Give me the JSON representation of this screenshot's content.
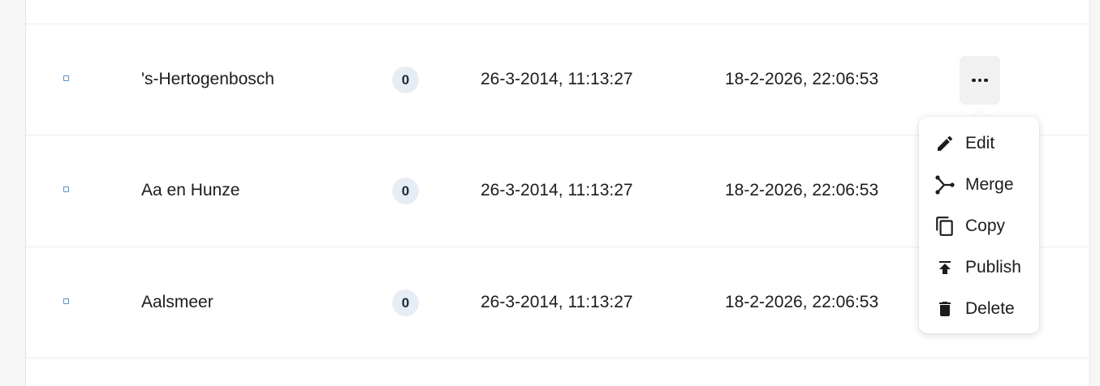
{
  "rows": [
    {
      "name": "'s-Hertogenbosch",
      "count": "0",
      "created": "26-3-2014, 11:13:27",
      "modified": "18-2-2026, 22:06:53"
    },
    {
      "name": "Aa en Hunze",
      "count": "0",
      "created": "26-3-2014, 11:13:27",
      "modified": "18-2-2026, 22:06:53"
    },
    {
      "name": "Aalsmeer",
      "count": "0",
      "created": "26-3-2014, 11:13:27",
      "modified": "18-2-2026, 22:06:53"
    }
  ],
  "context_menu": {
    "items": [
      {
        "label": "Edit",
        "icon": "pencil-icon"
      },
      {
        "label": "Merge",
        "icon": "merge-icon"
      },
      {
        "label": "Copy",
        "icon": "copy-icon"
      },
      {
        "label": "Publish",
        "icon": "publish-icon"
      },
      {
        "label": "Delete",
        "icon": "trash-icon"
      }
    ]
  },
  "colors": {
    "accent": "#5a8fc4",
    "badge_bg": "#e6edf4",
    "more_button_bg": "#f1f1f1"
  }
}
